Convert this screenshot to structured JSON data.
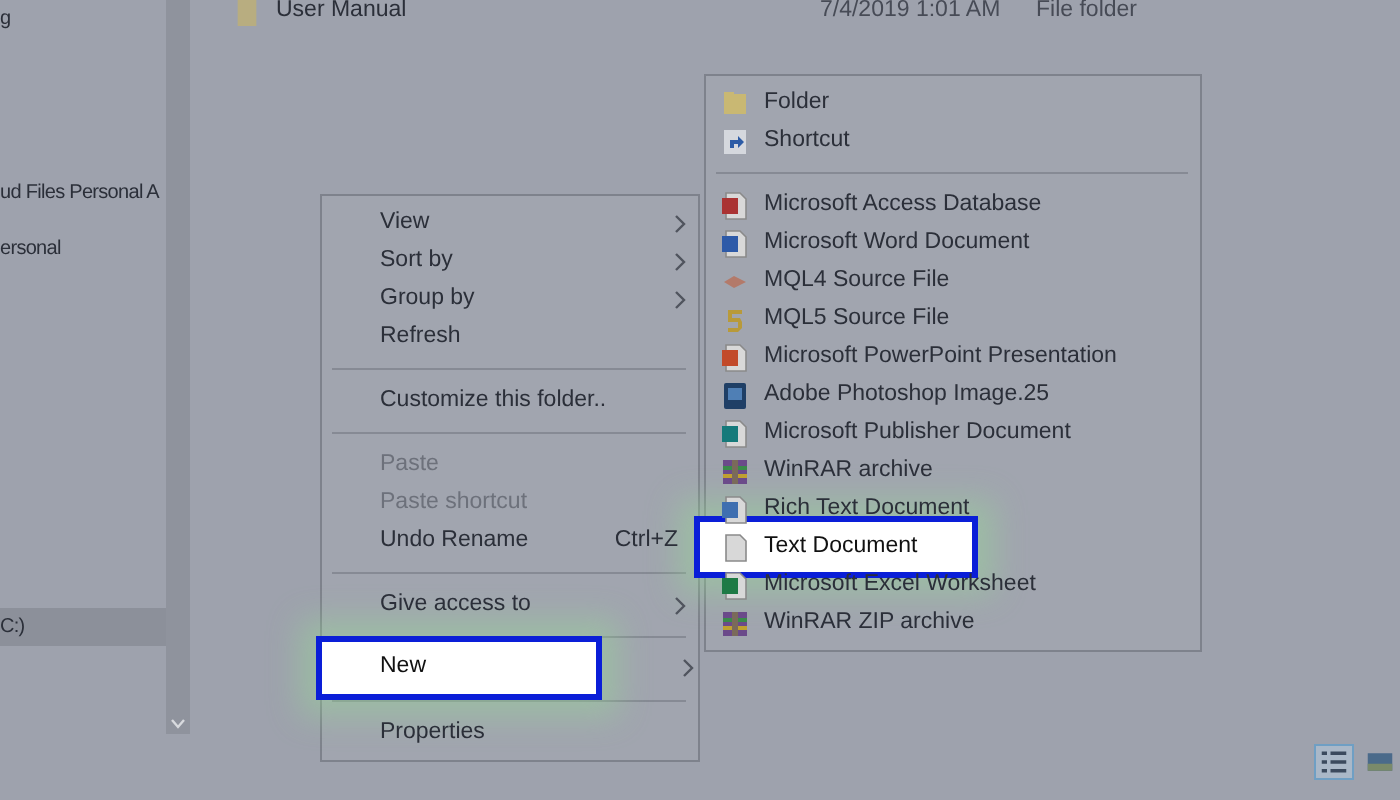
{
  "nav_pane": {
    "items": [
      {
        "label": "g",
        "selected": false
      },
      {
        "label": "ud Files Personal A",
        "selected": false
      },
      {
        "label": "ersonal",
        "selected": false
      },
      {
        "label": "C:)",
        "selected": true
      }
    ]
  },
  "file_list": {
    "rows": [
      {
        "name": "User Manual",
        "date_modified": "7/4/2019 1:01 AM",
        "type": "File folder"
      }
    ]
  },
  "context_menu": {
    "items": [
      {
        "kind": "item",
        "label": "View",
        "submenu": true,
        "disabled": false,
        "highlighted": false
      },
      {
        "kind": "item",
        "label": "Sort by",
        "submenu": true,
        "disabled": false,
        "highlighted": false
      },
      {
        "kind": "item",
        "label": "Group by",
        "submenu": true,
        "disabled": false,
        "highlighted": false
      },
      {
        "kind": "item",
        "label": "Refresh",
        "submenu": false,
        "disabled": false,
        "highlighted": false
      },
      {
        "kind": "separator"
      },
      {
        "kind": "item",
        "label": "Customize this folder..",
        "submenu": false,
        "disabled": false,
        "highlighted": false
      },
      {
        "kind": "separator"
      },
      {
        "kind": "item",
        "label": "Paste",
        "submenu": false,
        "disabled": true,
        "highlighted": false
      },
      {
        "kind": "item",
        "label": "Paste shortcut",
        "submenu": false,
        "disabled": true,
        "highlighted": false
      },
      {
        "kind": "item",
        "label": "Undo Rename",
        "shortcut": "Ctrl+Z",
        "submenu": false,
        "disabled": false,
        "highlighted": false
      },
      {
        "kind": "separator"
      },
      {
        "kind": "item",
        "label": "Give access to",
        "submenu": true,
        "disabled": false,
        "highlighted": false
      },
      {
        "kind": "separator"
      },
      {
        "kind": "item",
        "label": "New",
        "submenu": true,
        "disabled": false,
        "highlighted": true
      },
      {
        "kind": "separator"
      },
      {
        "kind": "item",
        "label": "Properties",
        "submenu": false,
        "disabled": false,
        "highlighted": false
      }
    ]
  },
  "new_submenu": {
    "items": [
      {
        "kind": "folder",
        "label": "Folder",
        "highlighted": false
      },
      {
        "kind": "shortcut",
        "label": "Shortcut",
        "highlighted": false
      },
      {
        "kind": "separator"
      },
      {
        "kind": "access",
        "label": "Microsoft Access Database",
        "highlighted": false
      },
      {
        "kind": "word",
        "label": "Microsoft Word Document",
        "highlighted": false
      },
      {
        "kind": "mql4",
        "label": "MQL4 Source File",
        "highlighted": false
      },
      {
        "kind": "mql5",
        "label": "MQL5 Source File",
        "highlighted": false
      },
      {
        "kind": "powerpoint",
        "label": "Microsoft PowerPoint Presentation",
        "highlighted": false
      },
      {
        "kind": "photoshop",
        "label": "Adobe Photoshop Image.25",
        "highlighted": false
      },
      {
        "kind": "publisher",
        "label": "Microsoft Publisher Document",
        "highlighted": false
      },
      {
        "kind": "archive",
        "label": "WinRAR archive",
        "highlighted": false
      },
      {
        "kind": "richtext",
        "label": "Rich Text Document",
        "highlighted": false
      },
      {
        "kind": "text",
        "label": "Text Document",
        "highlighted": true
      },
      {
        "kind": "excel",
        "label": "Microsoft Excel Worksheet",
        "highlighted": false
      },
      {
        "kind": "archive",
        "label": "WinRAR ZIP archive",
        "highlighted": false
      }
    ]
  },
  "view_buttons": [
    {
      "kind": "details",
      "selected": true
    },
    {
      "kind": "large_icons",
      "selected": false
    }
  ]
}
